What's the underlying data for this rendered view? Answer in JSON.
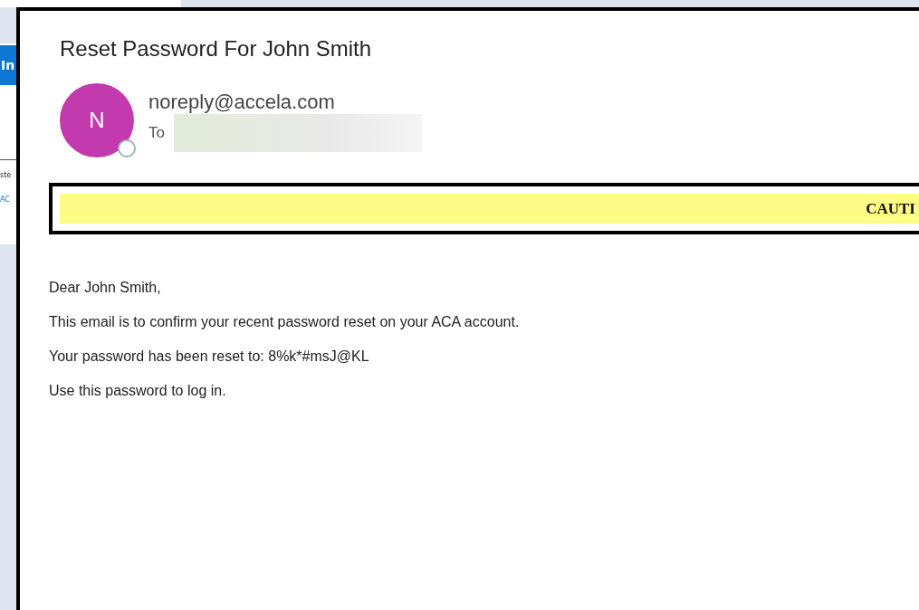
{
  "background_page": {
    "button": "In",
    "text": "ste",
    "link": "AC"
  },
  "email": {
    "subject": "Reset Password For John Smith",
    "sender": {
      "initial": "N",
      "address": "noreply@accela.com",
      "status_online": false
    },
    "to_label": "To",
    "banner": {
      "text": "CAUTI"
    },
    "body": [
      "Dear John Smith,",
      "This email is to confirm your recent password reset on your ACA account.",
      "Your password has been reset to: 8%k*#msJ@KL",
      "Use this password to log in."
    ]
  }
}
